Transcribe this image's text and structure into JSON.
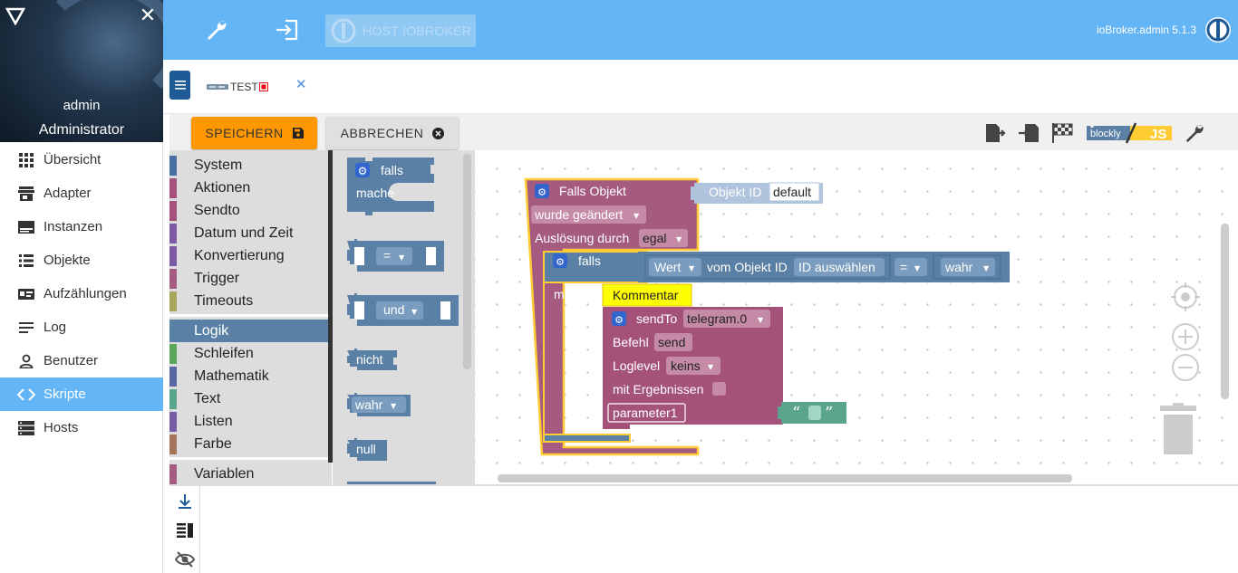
{
  "sidebar": {
    "user": "admin",
    "role": "Administrator",
    "items": [
      {
        "label": "Übersicht",
        "icon": "grid-icon"
      },
      {
        "label": "Adapter",
        "icon": "store-icon"
      },
      {
        "label": "Instanzen",
        "icon": "instances-icon"
      },
      {
        "label": "Objekte",
        "icon": "list-icon"
      },
      {
        "label": "Aufzählungen",
        "icon": "badge-icon"
      },
      {
        "label": "Log",
        "icon": "log-lines-icon"
      },
      {
        "label": "Benutzer",
        "icon": "user-icon"
      },
      {
        "label": "Skripte",
        "icon": "code-icon"
      },
      {
        "label": "Hosts",
        "icon": "server-icon"
      }
    ],
    "active": "Skripte"
  },
  "topbar": {
    "host_label": "HOST IOBROKER",
    "version": "ioBroker.admin 5.1.3"
  },
  "tabs": [
    {
      "label": "TEST"
    }
  ],
  "toolbar": {
    "save_label": "SPEICHERN",
    "cancel_label": "ABBRECHEN",
    "blockly_label": "blockly",
    "js_label": "JS"
  },
  "categories": [
    {
      "label": "System",
      "color": "#4a6fa5"
    },
    {
      "label": "Aktionen",
      "color": "#a5527a"
    },
    {
      "label": "Sendto",
      "color": "#a5527a"
    },
    {
      "label": "Datum und Zeit",
      "color": "#7b5ba5"
    },
    {
      "label": "Konvertierung",
      "color": "#7b5ba5"
    },
    {
      "label": "Trigger",
      "color": "#a55b80"
    },
    {
      "label": "Timeouts",
      "color": "#a5a55b"
    },
    {
      "label": "Logik",
      "color": "#5b80a5"
    },
    {
      "label": "Schleifen",
      "color": "#5ba55b"
    },
    {
      "label": "Mathematik",
      "color": "#5b67a5"
    },
    {
      "label": "Text",
      "color": "#5ba58c"
    },
    {
      "label": "Listen",
      "color": "#745ba5"
    },
    {
      "label": "Farbe",
      "color": "#a5745b"
    },
    {
      "label": "Variablen",
      "color": "#a55b80"
    }
  ],
  "selected_category": "Logik",
  "flyout": {
    "if_label": "falls",
    "do_label": "mache",
    "eq_op": "=",
    "and_op": "und",
    "not_label": "nicht",
    "true_label": "wahr",
    "null_label": "null"
  },
  "workspace": {
    "trigger": {
      "title": "Falls Objekt",
      "obj_label": "Objekt ID",
      "obj_value": "default",
      "condition": "wurde geändert",
      "ack_label": "Auslösung durch",
      "ack_value": "egal"
    },
    "if_block": {
      "if_label": "falls",
      "do_label": "mache",
      "value_field": "Wert",
      "from_label": "vom Objekt ID",
      "id_field": "ID auswählen",
      "op": "=",
      "compare": "wahr"
    },
    "comment": "Kommentar",
    "sendto": {
      "title": "sendTo",
      "instance": "telegram.0",
      "cmd_label": "Befehl",
      "cmd_value": "send",
      "loglevel_label": "Loglevel",
      "loglevel_value": "keins",
      "results_label": "mit Ergebnissen",
      "param_label": "parameter1"
    }
  },
  "colors": {
    "topbar": "#64b5f6",
    "accent_save": "#ff9800",
    "trigger_block": "#a55b80",
    "logic_block": "#5b80a5",
    "sendto_block": "#a5527a",
    "text_block": "#5ba58c",
    "highlight": "#fc3"
  }
}
